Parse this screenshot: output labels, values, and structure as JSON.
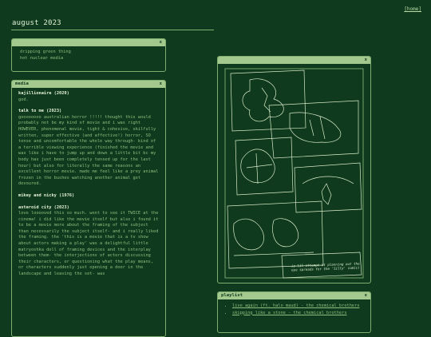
{
  "nav": {
    "home_label": "[home]"
  },
  "page": {
    "title": "august 2023"
  },
  "notes_widget": {
    "close_label": "x",
    "lines": [
      "dripping green thing",
      "hot nuclear media"
    ]
  },
  "media_widget": {
    "title": "media",
    "close_label": "x",
    "entries": [
      {
        "title": "kajillionaire (2020)",
        "text": "god."
      },
      {
        "title": "talk to me (2023)",
        "text": "goooooooo australian horror !!!!! thought this would probably not be my kind of movie and i was right HOWEVER, phenomenal movie, tight & cohesive, skilfully written, super effective (and affective!) horror, SO tense and uncomfortable the whole way through- kind of a terrible viewing experience (finished the movie and was like i have to jump up and down a little bit bc my body has just been completely tensed up for the last hour) but also for literally the same reasons an excellent horror movie. made me feel like a prey animal frozen in the bushes watching another animal get devoured."
      },
      {
        "title": "mikey and nicky (1976)",
        "text": ""
      },
      {
        "title": "asteroid city (2023)",
        "text": "love looooved this so much. went to see it TWICE at the cinema! i did like the movie itself but also i found it to be a movie more about the framing of the subject than necessarily the subject itself- and i really liked the framing. the 'this is a movie that is a tv show about actors making a play' was a delightful little matryoshka doll of framing devices and the interplay between them- the interjections of actors discussing their characters, or questioning what the play means, or characters suddenly just opening a door in the landscape and leaving the set- was"
      }
    ]
  },
  "image_widget": {
    "close_label": "x",
    "caption": "(a lil attempt at planning out the eye spreads for the 'Silly' comic)"
  },
  "playlist_widget": {
    "title": "playlist",
    "close_label": "x",
    "items": [
      "live again (ft. halo maud) - the chemical brothers",
      "skipping like a stone - the chemical brothers"
    ]
  }
}
